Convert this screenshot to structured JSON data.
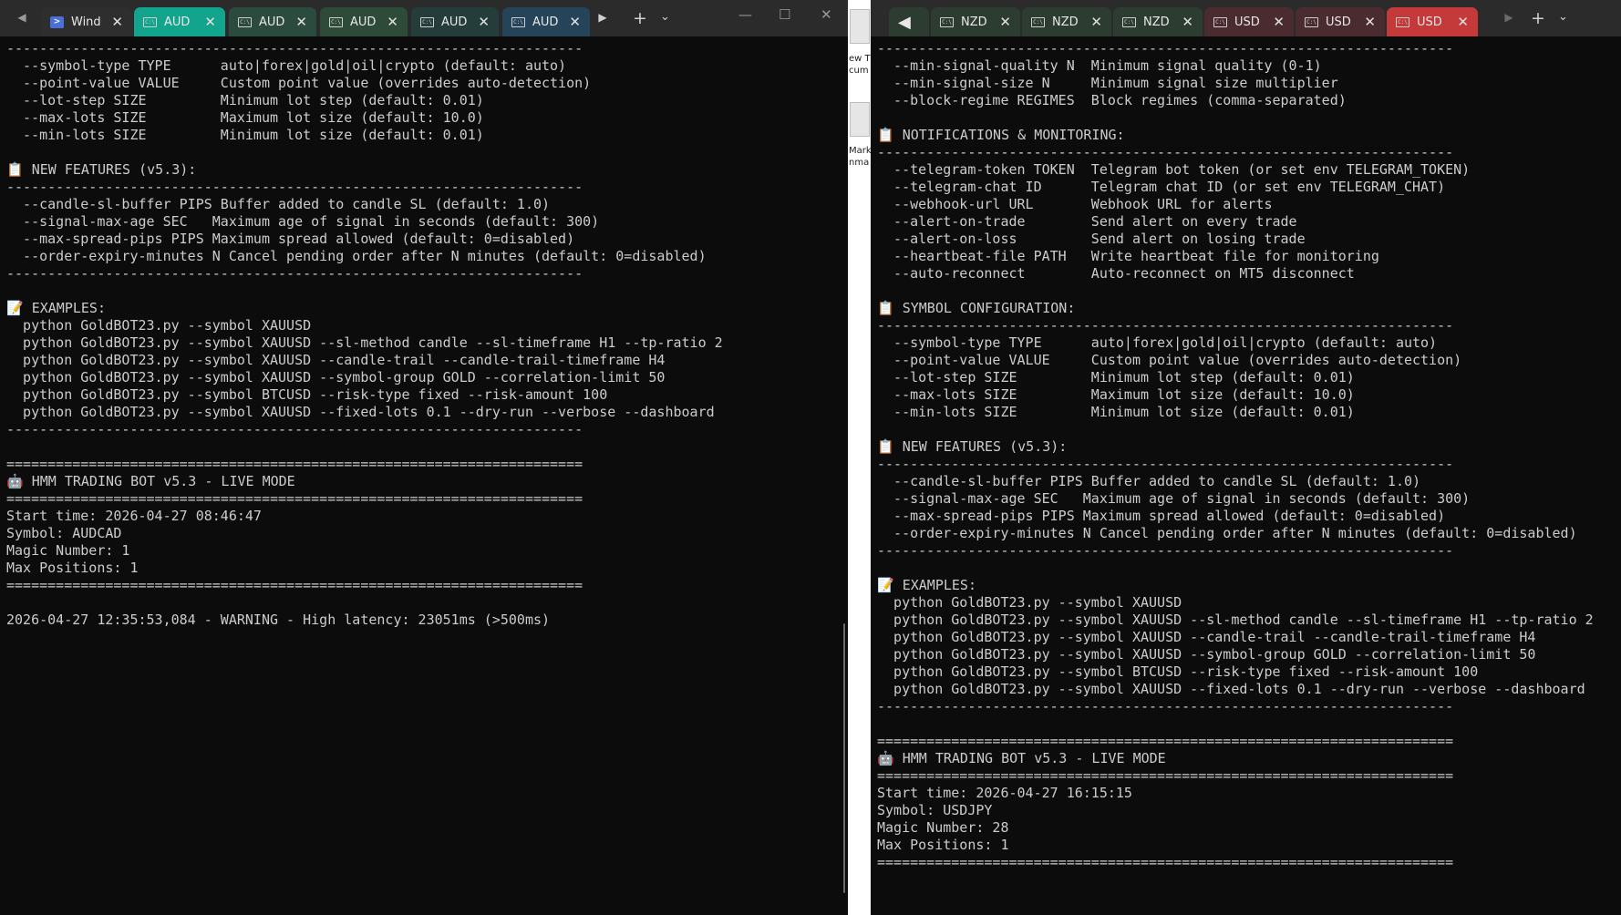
{
  "left": {
    "tabs": [
      {
        "label": "Wind",
        "icon": "powershell-icon",
        "bg": "#2e2e2e"
      },
      {
        "label": "AUD",
        "icon": "terminal-icon",
        "bg": "#12a48c"
      },
      {
        "label": "AUD",
        "icon": "terminal-icon",
        "bg": "#2c4b3f"
      },
      {
        "label": "AUD",
        "icon": "terminal-icon",
        "bg": "#2e4a38"
      },
      {
        "label": "AUD",
        "icon": "terminal-icon",
        "bg": "#243d3a"
      },
      {
        "label": "AUD",
        "icon": "terminal-icon",
        "bg": "#25445a"
      }
    ],
    "controls": {
      "close": "✕",
      "prev": "◀",
      "next": "▶",
      "add": "+",
      "dropdown": "⌄",
      "minimize": "—",
      "maximize": "☐",
      "close_window": "✕"
    },
    "lines": [
      "----------------------------------------------------------------------",
      "  --symbol-type TYPE      auto|forex|gold|oil|crypto (default: auto)",
      "  --point-value VALUE     Custom point value (overrides auto-detection)",
      "  --lot-step SIZE         Minimum lot step (default: 0.01)",
      "  --max-lots SIZE         Maximum lot size (default: 10.0)",
      "  --min-lots SIZE         Minimum lot size (default: 0.01)",
      "",
      "📋 NEW FEATURES (v5.3):",
      "----------------------------------------------------------------------",
      "  --candle-sl-buffer PIPS Buffer added to candle SL (default: 1.0)",
      "  --signal-max-age SEC   Maximum age of signal in seconds (default: 300)",
      "  --max-spread-pips PIPS Maximum spread allowed (default: 0=disabled)",
      "  --order-expiry-minutes N Cancel pending order after N minutes (default: 0=disabled)",
      "----------------------------------------------------------------------",
      "",
      "📝 EXAMPLES:",
      "  python GoldBOT23.py --symbol XAUUSD",
      "  python GoldBOT23.py --symbol XAUUSD --sl-method candle --sl-timeframe H1 --tp-ratio 2",
      "  python GoldBOT23.py --symbol XAUUSD --candle-trail --candle-trail-timeframe H4",
      "  python GoldBOT23.py --symbol XAUUSD --symbol-group GOLD --correlation-limit 50",
      "  python GoldBOT23.py --symbol BTCUSD --risk-type fixed --risk-amount 100",
      "  python GoldBOT23.py --symbol XAUUSD --fixed-lots 0.1 --dry-run --verbose --dashboard",
      "----------------------------------------------------------------------",
      "",
      "======================================================================",
      "🤖 HMM TRADING BOT v5.3 - LIVE MODE",
      "======================================================================",
      "Start time: 2026-04-27 08:46:47",
      "Symbol: AUDCAD",
      "Magic Number: 1",
      "Max Positions: 1",
      "======================================================================",
      "",
      "2026-04-27 12:35:53,084 - WARNING - High latency: 23051ms (>500ms)"
    ]
  },
  "desktop": {
    "texts": [
      "ew T",
      "cum",
      "Marko",
      "nma"
    ]
  },
  "right": {
    "tabs": [
      {
        "label": "",
        "icon": "",
        "bg": "#2c3c30"
      },
      {
        "label": "NZD",
        "icon": "terminal-icon",
        "bg": "#2c3c30"
      },
      {
        "label": "NZD",
        "icon": "terminal-icon",
        "bg": "#2c3c30"
      },
      {
        "label": "NZD",
        "icon": "terminal-icon",
        "bg": "#2c3c30"
      },
      {
        "label": "USD",
        "icon": "terminal-icon",
        "bg": "#4a2b2f"
      },
      {
        "label": "USD",
        "icon": "terminal-icon",
        "bg": "#4a2b2f"
      },
      {
        "label": "USD",
        "icon": "terminal-icon",
        "bg": "#c43a3a"
      }
    ],
    "controls": {
      "close": "✕",
      "prev": "◀",
      "next": "▶",
      "add": "+",
      "dropdown": "⌄"
    },
    "lines": [
      "----------------------------------------------------------------------",
      "  --min-signal-quality N  Minimum signal quality (0-1)",
      "  --min-signal-size N     Minimum signal size multiplier",
      "  --block-regime REGIMES  Block regimes (comma-separated)",
      "",
      "📋 NOTIFICATIONS & MONITORING:",
      "----------------------------------------------------------------------",
      "  --telegram-token TOKEN  Telegram bot token (or set env TELEGRAM_TOKEN)",
      "  --telegram-chat ID      Telegram chat ID (or set env TELEGRAM_CHAT)",
      "  --webhook-url URL       Webhook URL for alerts",
      "  --alert-on-trade        Send alert on every trade",
      "  --alert-on-loss         Send alert on losing trade",
      "  --heartbeat-file PATH   Write heartbeat file for monitoring",
      "  --auto-reconnect        Auto-reconnect on MT5 disconnect",
      "",
      "📋 SYMBOL CONFIGURATION:",
      "----------------------------------------------------------------------",
      "  --symbol-type TYPE      auto|forex|gold|oil|crypto (default: auto)",
      "  --point-value VALUE     Custom point value (overrides auto-detection)",
      "  --lot-step SIZE         Minimum lot step (default: 0.01)",
      "  --max-lots SIZE         Maximum lot size (default: 10.0)",
      "  --min-lots SIZE         Minimum lot size (default: 0.01)",
      "",
      "📋 NEW FEATURES (v5.3):",
      "----------------------------------------------------------------------",
      "  --candle-sl-buffer PIPS Buffer added to candle SL (default: 1.0)",
      "  --signal-max-age SEC   Maximum age of signal in seconds (default: 300)",
      "  --max-spread-pips PIPS Maximum spread allowed (default: 0=disabled)",
      "  --order-expiry-minutes N Cancel pending order after N minutes (default: 0=disabled)",
      "----------------------------------------------------------------------",
      "",
      "📝 EXAMPLES:",
      "  python GoldBOT23.py --symbol XAUUSD",
      "  python GoldBOT23.py --symbol XAUUSD --sl-method candle --sl-timeframe H1 --tp-ratio 2",
      "  python GoldBOT23.py --symbol XAUUSD --candle-trail --candle-trail-timeframe H4",
      "  python GoldBOT23.py --symbol XAUUSD --symbol-group GOLD --correlation-limit 50",
      "  python GoldBOT23.py --symbol BTCUSD --risk-type fixed --risk-amount 100",
      "  python GoldBOT23.py --symbol XAUUSD --fixed-lots 0.1 --dry-run --verbose --dashboard",
      "----------------------------------------------------------------------",
      "",
      "======================================================================",
      "🤖 HMM TRADING BOT v5.3 - LIVE MODE",
      "======================================================================",
      "Start time: 2026-04-27 16:15:15",
      "Symbol: USDJPY",
      "Magic Number: 28",
      "Max Positions: 1",
      "======================================================================"
    ]
  }
}
